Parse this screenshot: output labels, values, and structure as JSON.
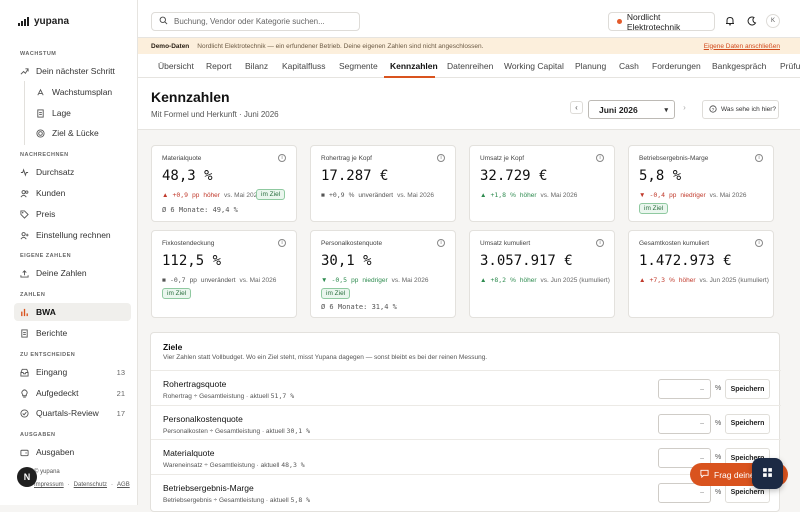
{
  "app": {
    "name": "yupana"
  },
  "sidebar": {
    "sections": {
      "wachstum": "WACHSTUM",
      "nachrechnen": "NACHRECHNEN",
      "eigene": "EIGENE ZAHLEN",
      "zahlen": "ZAHLEN",
      "entscheiden": "ZU ENTSCHEIDEN",
      "ausgaben": "AUSGABEN"
    },
    "items": {
      "schritt": "Dein nächster Schritt",
      "wachstumsplan": "Wachstumsplan",
      "lage": "Lage",
      "ziel": "Ziel & Lücke",
      "durchsatz": "Durchsatz",
      "kunden": "Kunden",
      "preis": "Preis",
      "einstellung": "Einstellung rechnen",
      "deine_zahlen": "Deine Zahlen",
      "bwa": "BWA",
      "berichte": "Berichte",
      "eingang": "Eingang",
      "eingang_count": "13",
      "aufgedeckt": "Aufgedeckt",
      "aufgedeckt_count": "21",
      "quartal": "Quartals-Review",
      "quartal_count": "17",
      "ausgaben": "Ausgaben"
    },
    "avatar_letter": "N",
    "footer": {
      "brand": "© yupana",
      "impressum": "Impressum",
      "datenschutz": "Datenschutz",
      "agb": "AGB",
      "sep": "·"
    }
  },
  "topbar": {
    "search_placeholder": "Buchung, Vendor oder Kategorie suchen...",
    "company": "Nordlicht Elektrotechnik",
    "user_initial": "K"
  },
  "banner": {
    "label": "Demo-Daten",
    "text": "Nordlicht Elektrotechnik — ein erfundener Betrieb. Deine eigenen Zahlen sind nicht angeschlossen.",
    "link": "Eigene Daten anschließen"
  },
  "tabs": [
    "Übersicht",
    "Report",
    "Bilanz",
    "Kapitalfluss",
    "Segmente",
    "Kennzahlen",
    "Datenreihen",
    "Working Capital",
    "Planung",
    "Cash",
    "Forderungen",
    "Bankgespräch",
    "Prüfung"
  ],
  "header": {
    "title": "Kennzahlen",
    "subtitle": "Mit Formel und Herkunft · Juni 2026",
    "month": "Juni 2026",
    "help": "Was sehe ich hier?",
    "prev": "‹",
    "next": "›"
  },
  "cards": [
    {
      "label": "Materialquote",
      "value": "48,3 %",
      "arrow": "▲",
      "delta": "+0,9",
      "unit": "pp",
      "dir": "höher",
      "cmp": "vs. Mai 2026",
      "badge": "im Ziel",
      "avg": "Ø 6 Monate: 49,4 %",
      "color": "red"
    },
    {
      "label": "Rohertrag je Kopf",
      "value": "17.287 €",
      "arrow": "■",
      "delta": "+0,9",
      "unit": "%",
      "dir": "unverändert",
      "cmp": "vs. Mai 2026",
      "badge": "",
      "avg": "",
      "color": "neutral"
    },
    {
      "label": "Umsatz je Kopf",
      "value": "32.729 €",
      "arrow": "▲",
      "delta": "+1,8",
      "unit": "%",
      "dir": "höher",
      "cmp": "vs. Mai 2026",
      "badge": "",
      "avg": "",
      "color": "green"
    },
    {
      "label": "Betriebsergebnis-Marge",
      "value": "5,8 %",
      "arrow": "▼",
      "delta": "-0,4",
      "unit": "pp",
      "dir": "niedriger",
      "cmp": "vs. Mai 2026",
      "badge": "im Ziel",
      "avg": "",
      "color": "red"
    },
    {
      "label": "Fixkostendeckung",
      "value": "112,5 %",
      "arrow": "■",
      "delta": "-0,7",
      "unit": "pp",
      "dir": "unverändert",
      "cmp": "vs. Mai 2026",
      "badge": "im Ziel",
      "avg": "",
      "color": "neutral"
    },
    {
      "label": "Personalkostenquote",
      "value": "30,1 %",
      "arrow": "▼",
      "delta": "-0,5",
      "unit": "pp",
      "dir": "niedriger",
      "cmp": "vs. Mai 2026",
      "badge": "im Ziel",
      "avg": "Ø 6 Monate: 31,4 %",
      "color": "green"
    },
    {
      "label": "Umsatz kumuliert",
      "value": "3.057.917 €",
      "arrow": "▲",
      "delta": "+8,2",
      "unit": "%",
      "dir": "höher",
      "cmp": "vs. Jun 2025 (kumuliert)",
      "badge": "",
      "avg": "",
      "color": "green"
    },
    {
      "label": "Gesamtkosten kumuliert",
      "value": "1.472.973 €",
      "arrow": "▲",
      "delta": "+7,3",
      "unit": "%",
      "dir": "höher",
      "cmp": "vs. Jun 2025 (kumuliert)",
      "badge": "",
      "avg": "",
      "color": "red"
    }
  ],
  "goals": {
    "title": "Ziele",
    "desc": "Vier Zahlen statt Vollbudget. Wo ein Ziel steht, misst Yupana dagegen — sonst bleibt es bei der reinen Messung.",
    "input_placeholder": "–",
    "pct": "%",
    "save": "Speichern",
    "rows": [
      {
        "name": "Rohertragsquote",
        "formula": "Rohertrag ÷ Gesamtleistung · aktuell",
        "current": "51,7 %"
      },
      {
        "name": "Personalkostenquote",
        "formula": "Personalkosten ÷ Gesamtleistung · aktuell",
        "current": "30,1 %"
      },
      {
        "name": "Materialquote",
        "formula": "Wareneinsatz ÷ Gesamtleistung · aktuell",
        "current": "48,3 %"
      },
      {
        "name": "Betriebsergebnis-Marge",
        "formula": "Betriebsergebnis ÷ Gesamtleistung · aktuell",
        "current": "5,8 %"
      }
    ]
  },
  "ask_button": "Frag deine",
  "colors": {
    "accent": "#d9531e",
    "red": "#c0392b",
    "green": "#2e8b4f",
    "banner": "#fcefdc"
  }
}
